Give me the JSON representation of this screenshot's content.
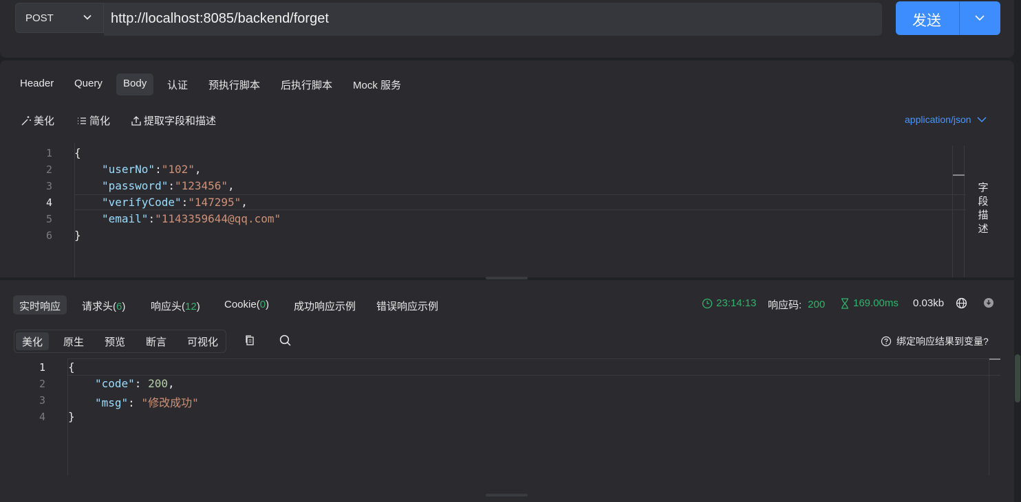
{
  "request": {
    "method": "POST",
    "url": "http://localhost:8085/backend/forget",
    "send_label": "发送"
  },
  "request_tabs": [
    "Header",
    "Query",
    "Body",
    "认证",
    "预执行脚本",
    "后执行脚本",
    "Mock 服务"
  ],
  "active_request_tab": "Body",
  "body_toolbar": {
    "beautify": "美化",
    "simplify": "简化",
    "extract": "提取字段和描述",
    "content_type": "application/json"
  },
  "body_lines": [
    "1",
    "2",
    "3",
    "4",
    "5",
    "6"
  ],
  "body_json": {
    "open": "{",
    "close": "}",
    "userNo_key": "\"userNo\"",
    "userNo_val": "\"102\"",
    "password_key": "\"password\"",
    "password_val": "\"123456\"",
    "verifyCode_key": "\"verifyCode\"",
    "verifyCode_val": "\"147295\"",
    "email_key": "\"email\"",
    "email_val": "\"1143359644@qq.com\""
  },
  "field_description_label": "字段描述",
  "field_description_chars": [
    "字",
    "段",
    "描",
    "述"
  ],
  "response_tabs": {
    "realtime": "实时响应",
    "req_headers": "请求头(",
    "req_headers_count": "6",
    "resp_headers": "响应头(",
    "resp_headers_count": "12",
    "cookie": "Cookie(",
    "cookie_count": "0",
    "close_paren": ")",
    "success_example": "成功响应示例",
    "error_example": "错误响应示例"
  },
  "response_meta": {
    "time": "23:14:13",
    "status_label": "响应码:",
    "status_code": "200",
    "duration": "169.00ms",
    "size": "0.03kb"
  },
  "response_modes": [
    "美化",
    "原生",
    "预览",
    "断言",
    "可视化"
  ],
  "bind_hint": "绑定响应结果到变量?",
  "response_lines": [
    "1",
    "2",
    "3",
    "4"
  ],
  "response_json": {
    "open": "{",
    "close": "}",
    "code_key": "\"code\"",
    "code_val": "200",
    "msg_key": "\"msg\"",
    "msg_val": "\"修改成功\""
  },
  "colors": {
    "accent": "#3d8dff",
    "success": "#2fb56b",
    "json_key": "#9cdcfe",
    "json_string": "#ce9178",
    "json_number": "#b5cea8"
  }
}
